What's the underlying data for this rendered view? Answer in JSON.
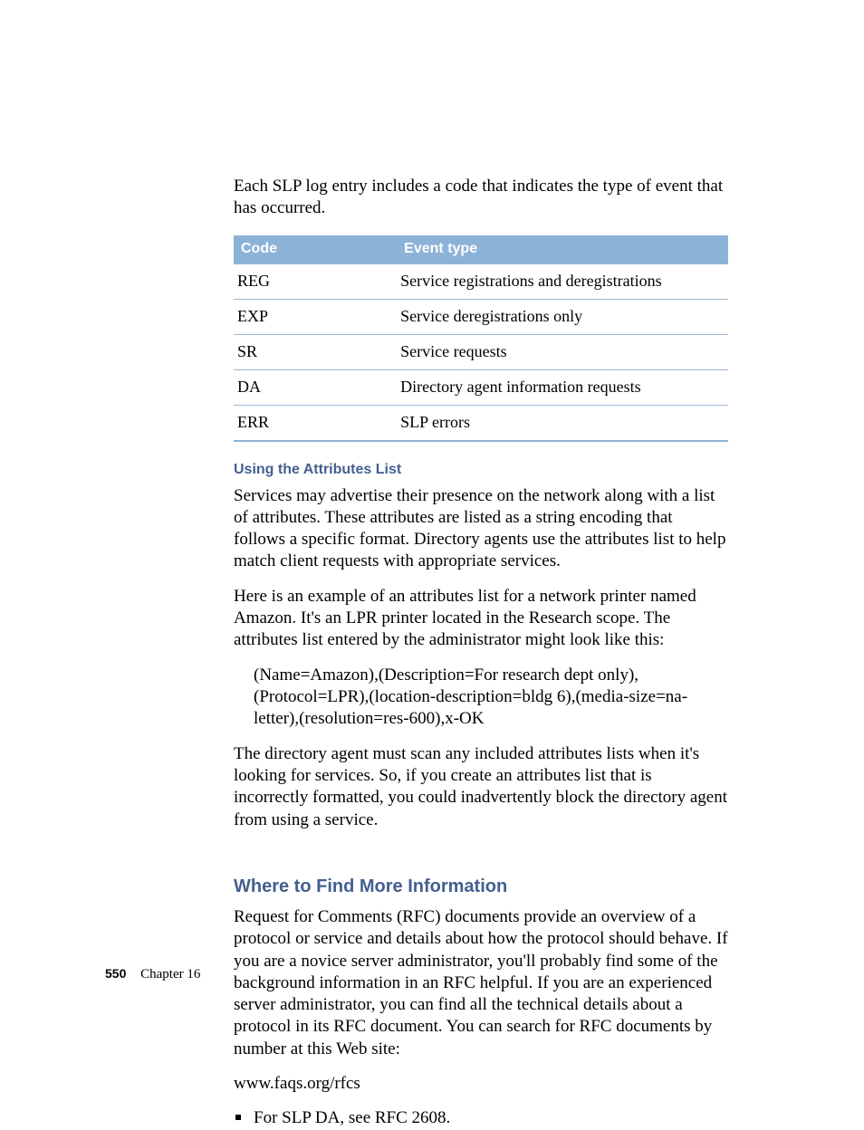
{
  "intro": "Each SLP log entry includes a code that indicates the type of event that has occurred.",
  "table": {
    "headers": {
      "code": "Code",
      "event": "Event type"
    },
    "rows": [
      {
        "code": "REG",
        "event": "Service registrations and deregistrations"
      },
      {
        "code": "EXP",
        "event": "Service deregistrations only"
      },
      {
        "code": "SR",
        "event": "Service requests"
      },
      {
        "code": "DA",
        "event": "Directory agent information requests"
      },
      {
        "code": "ERR",
        "event": "SLP errors"
      }
    ]
  },
  "attributes": {
    "heading": "Using the Attributes List",
    "p1": "Services may advertise their presence on the network along with a list of attributes. These attributes are listed as a string encoding that follows a specific format. Directory agents use the attributes list to help match client requests with appropriate services.",
    "p2": "Here is an example of an attributes list for a network printer named Amazon. It's an LPR printer located in the Research scope. The attributes list entered by the administrator might look like this:",
    "example": "(Name=Amazon),(Description=For research dept only),(Protocol=LPR),(location-description=bldg 6),(media-size=na-letter),(resolution=res-600),x-OK",
    "p3": "The directory agent must scan any included attributes lists when it's looking for services. So, if you create an attributes list that is incorrectly formatted, you could inadvertently block the directory agent from using a service."
  },
  "moreinfo": {
    "heading": "Where to Find More Information",
    "p1": "Request for Comments (RFC) documents provide an overview of a protocol or service and details about how the protocol should behave. If you are a novice server administrator, you'll probably find some of the background information in an RFC helpful. If you are an experienced server administrator, you can find all the technical details about a protocol in its RFC document. You can search for RFC documents by number at this Web site:",
    "url": "www.faqs.org/rfcs",
    "bullet1": "For SLP DA, see RFC 2608."
  },
  "footer": {
    "page": "550",
    "chapter": "Chapter  16"
  }
}
